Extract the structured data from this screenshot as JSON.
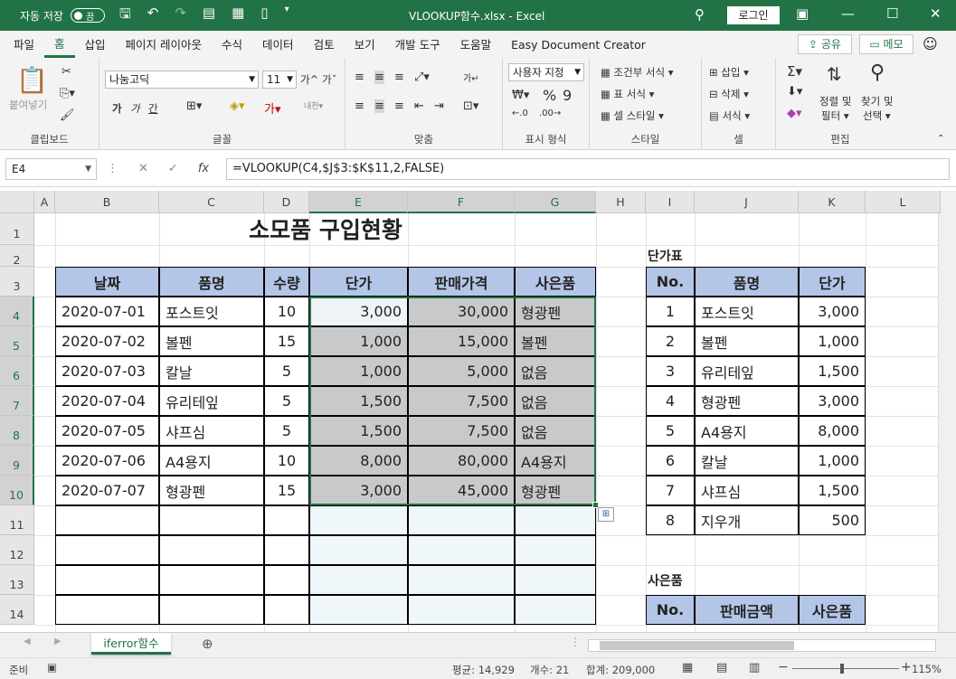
{
  "titlebar": {
    "autosave_label": "자동 저장",
    "autosave_state": "끔",
    "title": "VLOOKUP함수.xlsx  -  Excel",
    "login": "로그인"
  },
  "menu": {
    "tabs": [
      "파일",
      "홈",
      "삽입",
      "페이지 레이아웃",
      "수식",
      "데이터",
      "검토",
      "보기",
      "개발 도구",
      "도움말",
      "Easy Document Creator"
    ],
    "active_tab": "홈",
    "share": "공유",
    "memo": "메모"
  },
  "ribbon": {
    "clipboard": {
      "paste": "붙여넣기",
      "label": "클립보드"
    },
    "font": {
      "name": "나눔고딕",
      "size": "11",
      "grow": "가^",
      "shrink": "가ˇ",
      "bold": "가",
      "italic": "가",
      "underline": "간",
      "label": "글꼴"
    },
    "align": {
      "label": "맞춤"
    },
    "number": {
      "format": "사용자 지정",
      "label": "표시 형식"
    },
    "style": {
      "conditional": "조건부 서식",
      "table": "표 서식",
      "cell": "셀 스타일",
      "label": "스타일"
    },
    "cells": {
      "insert": "삽입",
      "delete": "삭제",
      "format": "서식",
      "label": "셀"
    },
    "edit": {
      "sort": "정렬 및",
      "filter": "필터",
      "find": "찾기 및",
      "select": "선택",
      "label": "편집"
    }
  },
  "formula_bar": {
    "name_box": "E4",
    "formula": "=VLOOKUP(C4,$J$3:$K$11,2,FALSE)"
  },
  "columns": [
    "A",
    "B",
    "C",
    "D",
    "E",
    "F",
    "G",
    "H",
    "I",
    "J",
    "K",
    "L"
  ],
  "rows": [
    "1",
    "2",
    "3",
    "4",
    "5",
    "6",
    "7",
    "8",
    "9",
    "10",
    "11",
    "12",
    "13",
    "14"
  ],
  "sheet": {
    "title": "소모품 구입현황",
    "headers": [
      "날짜",
      "품명",
      "수량",
      "단가",
      "판매가격",
      "사은품"
    ],
    "records": [
      [
        "2020-07-01",
        "포스트잇",
        "10",
        "3,000",
        "30,000",
        "형광펜"
      ],
      [
        "2020-07-02",
        "볼펜",
        "15",
        "1,000",
        "15,000",
        "볼펜"
      ],
      [
        "2020-07-03",
        "칼날",
        "5",
        "1,000",
        "5,000",
        "없음"
      ],
      [
        "2020-07-04",
        "유리테잎",
        "5",
        "1,500",
        "7,500",
        "없음"
      ],
      [
        "2020-07-05",
        "샤프심",
        "5",
        "1,500",
        "7,500",
        "없음"
      ],
      [
        "2020-07-06",
        "A4용지",
        "10",
        "8,000",
        "80,000",
        "A4용지"
      ],
      [
        "2020-07-07",
        "형광펜",
        "15",
        "3,000",
        "45,000",
        "형광펜"
      ]
    ],
    "price_table_title": "단가표",
    "price_headers": [
      "No.",
      "품명",
      "단가"
    ],
    "price_records": [
      [
        "1",
        "포스트잇",
        "3,000"
      ],
      [
        "2",
        "볼펜",
        "1,000"
      ],
      [
        "3",
        "유리테잎",
        "1,500"
      ],
      [
        "4",
        "형광펜",
        "3,000"
      ],
      [
        "5",
        "A4용지",
        "8,000"
      ],
      [
        "6",
        "칼날",
        "1,000"
      ],
      [
        "7",
        "샤프심",
        "1,500"
      ],
      [
        "8",
        "지우개",
        "500"
      ]
    ],
    "gift_table_title": "사은품",
    "gift_headers": [
      "No.",
      "판매금액",
      "사은품"
    ]
  },
  "sheet_tab": "iferror함수",
  "status": {
    "ready": "준비",
    "average": "평균: 14,929",
    "count": "개수: 21",
    "sum": "합계: 209,000",
    "zoom": "115%"
  }
}
